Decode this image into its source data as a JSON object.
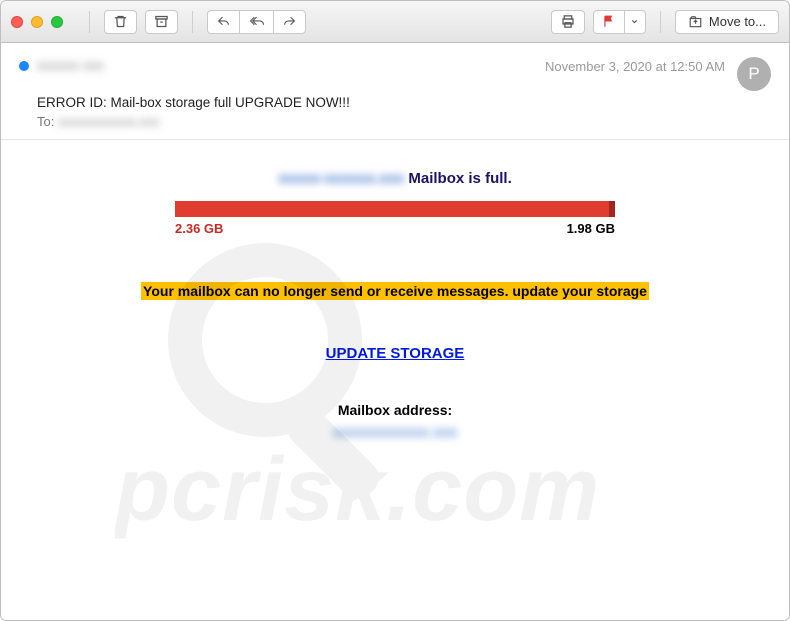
{
  "timestamp": "November 3, 2020 at 12:50 AM",
  "from_blurred": "xxxxxx xxx",
  "subject": "ERROR ID: Mail-box storage full UPGRADE NOW!!!",
  "to_label": "To:",
  "to_blurred": "xxxxxxxxxxxx.xxx",
  "avatar_letter": "P",
  "body": {
    "title_prefix_blurred": "xxxxx-xxxxxx.xxx",
    "title_suffix": " Mailbox is full.",
    "used_label": "2.36 GB",
    "total_label": "1.98 GB",
    "warning": "Your mailbox can no longer send or receive messages. update your storage",
    "update_link": "UPDATE STORAGE",
    "address_label": "Mailbox address:",
    "address_blurred": "xxxxxxxxxxxx.xxx"
  },
  "toolbar": {
    "move_to": "Move to...",
    "icons": {
      "trash": "trash-icon",
      "archive": "archive-icon",
      "reply": "reply-icon",
      "reply_all": "reply-all-icon",
      "forward": "forward-icon",
      "print": "print-icon",
      "flag": "flag-icon",
      "flag_menu": "chevron-down-icon",
      "move": "move-to-folder-icon"
    }
  },
  "watermark": "pcrisk.com"
}
